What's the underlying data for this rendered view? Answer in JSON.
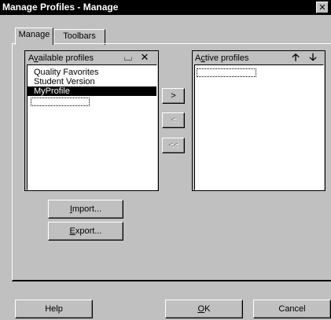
{
  "window": {
    "title": "Manage Profiles - Manage",
    "close_glyph": "✕"
  },
  "tabs": [
    {
      "label": "Manage",
      "active": true
    },
    {
      "label": "Toolbars",
      "active": false
    }
  ],
  "available": {
    "label_pre": "A",
    "label_key": "v",
    "label_post": "ailable profiles",
    "new_icon": "new-profile-icon",
    "new_glyph": "⌴",
    "delete_icon": "delete-icon",
    "delete_glyph": "✕",
    "items": [
      {
        "label": "Quality Favorites",
        "selected": false
      },
      {
        "label": "Student Version",
        "selected": false
      },
      {
        "label": "MyProfile",
        "selected": true
      }
    ]
  },
  "active": {
    "label_pre": "A",
    "label_key": "c",
    "label_post": "tive profiles",
    "up_glyph": "🡡",
    "down_glyph": "🡣"
  },
  "transfer": {
    "add": ">",
    "remove": "<",
    "remove_all": "<<"
  },
  "io": {
    "import_key": "I",
    "import_rest": "mport...",
    "export_key": "E",
    "export_rest": "xport..."
  },
  "footer": {
    "help": "Help",
    "ok_key": "O",
    "ok_rest": "K",
    "cancel": "Cancel"
  }
}
